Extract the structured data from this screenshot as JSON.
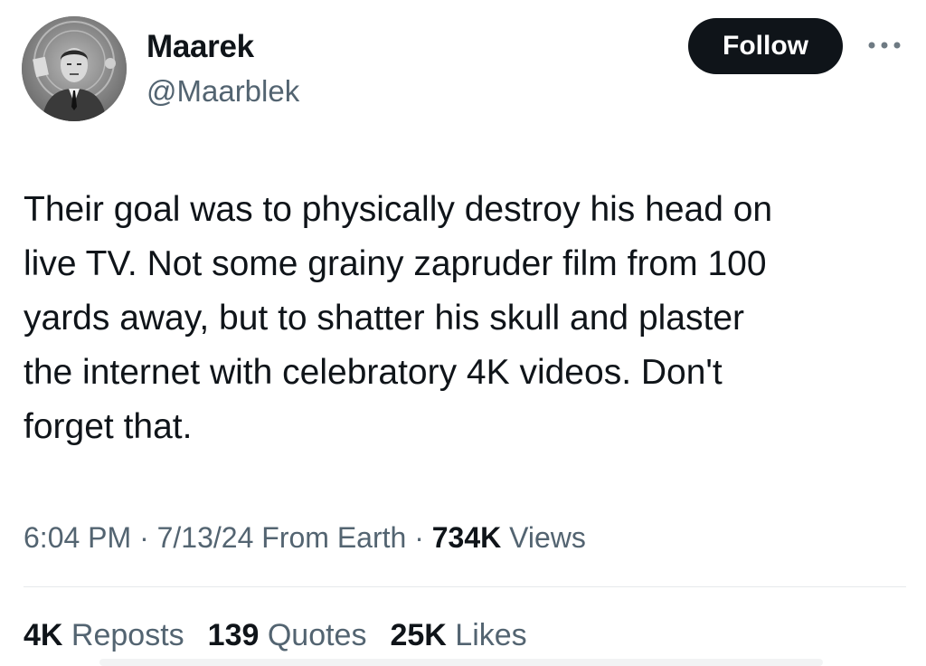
{
  "author": {
    "display_name": "Maarek",
    "handle": "@Maarblek",
    "avatar_icon": "profile-photo-man-in-suit"
  },
  "actions": {
    "follow_label": "Follow",
    "more_icon": "more-horizontal-icon"
  },
  "tweet": {
    "text": "Their goal was to physically destroy his head on\nlive TV. Not some grainy zapruder film from 100\nyards away, but to shatter his skull and plaster\nthe internet with celebratory 4K videos. Don't\nforget that."
  },
  "meta": {
    "time": "6:04 PM",
    "sep1": " · ",
    "date": "7/13/24",
    "source": " From Earth",
    "sep2": " · ",
    "views_count": "734K",
    "views_label": " Views"
  },
  "stats": [
    {
      "count": "4K",
      "label": "Reposts"
    },
    {
      "count": "139",
      "label": "Quotes"
    },
    {
      "count": "25K",
      "label": "Likes"
    }
  ],
  "colors": {
    "text_primary": "#0f1419",
    "text_secondary": "#536471",
    "button_bg": "#0f1419",
    "divider": "#e6e9eb"
  }
}
